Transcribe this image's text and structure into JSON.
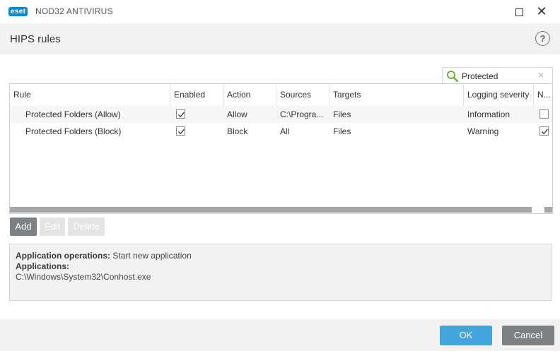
{
  "app": {
    "logo_text": "eset",
    "product_name": "NOD32 ANTIVIRUS"
  },
  "header": {
    "title": "HIPS rules",
    "help_label": "?"
  },
  "search": {
    "value": "Protected",
    "clear_label": "×"
  },
  "table": {
    "columns": [
      "Rule",
      "Enabled",
      "Action",
      "Sources",
      "Targets",
      "Logging severity",
      "N..."
    ],
    "rows": [
      {
        "rule": "Protected Folders (Allow)",
        "enabled": true,
        "action": "Allow",
        "sources": "C:\\Progra...",
        "targets": "Files",
        "logging": "Information",
        "notify": false
      },
      {
        "rule": "Protected Folders (Block)",
        "enabled": true,
        "action": "Block",
        "sources": "All",
        "targets": "Files",
        "logging": "Warning",
        "notify": true
      }
    ]
  },
  "buttons": {
    "add": "Add",
    "edit": "Edit",
    "delete": "Delete",
    "ok": "OK",
    "cancel": "Cancel"
  },
  "details": {
    "operations_label": "Application operations:",
    "operations_value": "Start new application",
    "applications_label": "Applications:",
    "applications_value": "C:\\Windows\\System32\\Conhost.exe"
  },
  "colors": {
    "accent": "#42a5dc",
    "brand": "#0b89cb",
    "neutral_button": "#7d8184"
  }
}
